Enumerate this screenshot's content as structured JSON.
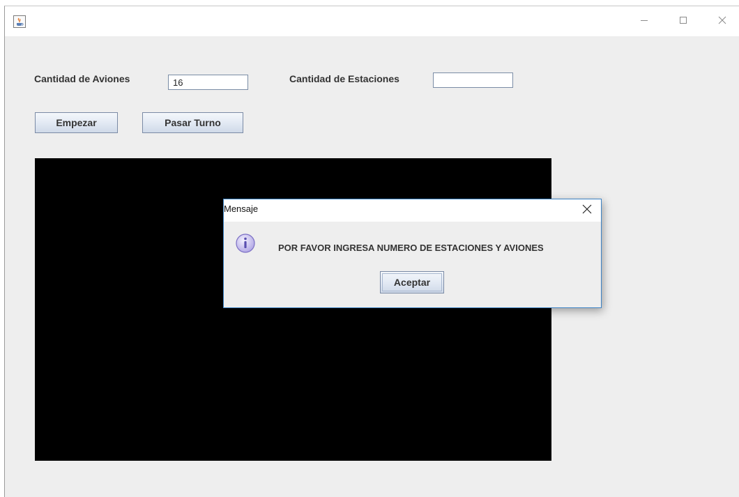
{
  "window": {
    "title": "",
    "app_icon": "java-cup-icon",
    "controls": {
      "minimize_icon": "minimize-icon",
      "maximize_icon": "maximize-icon",
      "close_icon": "close-icon"
    }
  },
  "form": {
    "aviones_label": "Cantidad de Aviones",
    "aviones_value": "16",
    "estaciones_label": "Cantidad de Estaciones",
    "estaciones_value": ""
  },
  "buttons": {
    "empezar": "Empezar",
    "pasar_turno": "Pasar Turno"
  },
  "canvas": {
    "background": "#000000"
  },
  "dialog": {
    "title": "Mensaje",
    "icon": "info-icon",
    "message": "POR FAVOR INGRESA NUMERO DE ESTACIONES Y AVIONES",
    "ok_label": "Aceptar",
    "border_color": "#3b82c4"
  }
}
